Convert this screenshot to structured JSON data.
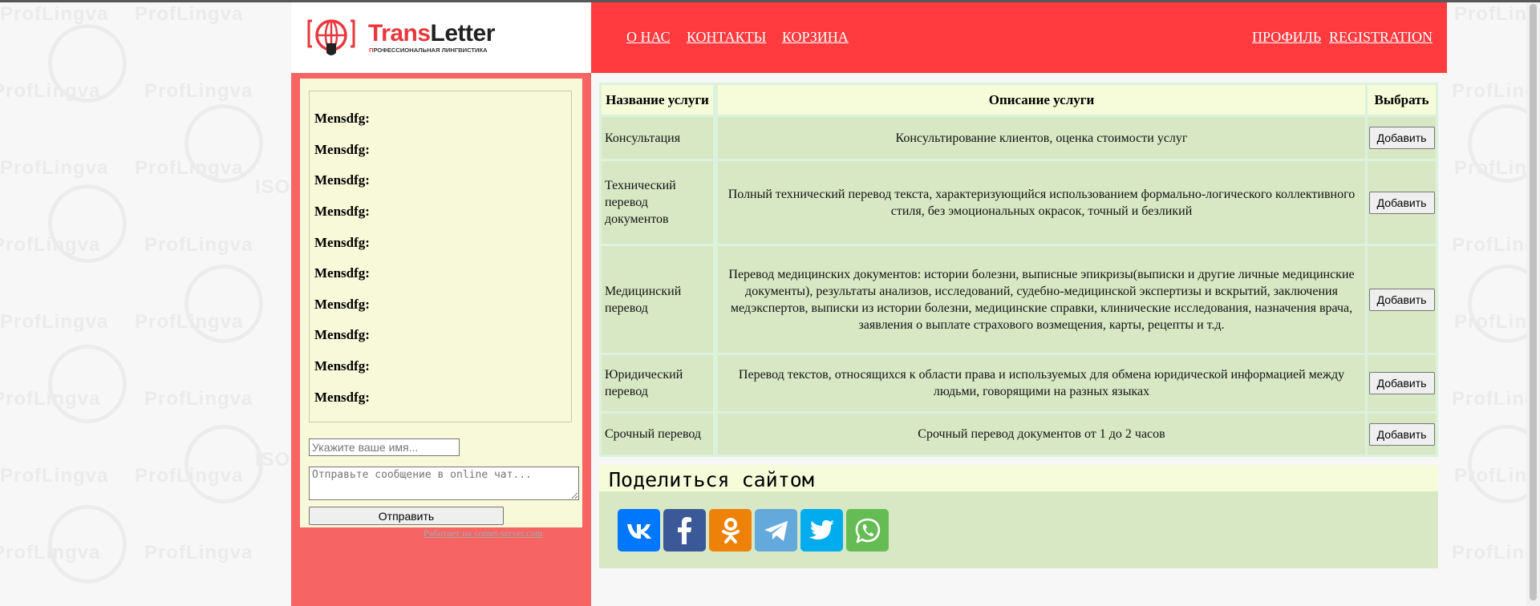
{
  "background": {
    "watermark": "ProfLingva",
    "iso": "ISO"
  },
  "brand": {
    "name_red": "Trans",
    "name_dark": "Letter",
    "tagline_red": "П",
    "tagline": "РОФЕССИОНАЛЬНАЯ ЛИНГВИСТИКА"
  },
  "nav": {
    "about": "О НАС",
    "contacts": "КОНТАКТЫ",
    "cart": "КОРЗИНА",
    "profile": "ПРОФИЛЬ",
    "registration": "REGISTRATION"
  },
  "chat": {
    "messages": [
      {
        "text": "Mensdfg:"
      },
      {
        "text": "Mensdfg:"
      },
      {
        "text": "Mensdfg:"
      },
      {
        "text": "Mensdfg:"
      },
      {
        "text": "Mensdfg:"
      },
      {
        "text": "Mensdfg:"
      },
      {
        "text": "Mensdfg:"
      },
      {
        "text": "Mensdfg:"
      },
      {
        "text": "Mensdfg:"
      },
      {
        "text": "Mensdfg:"
      }
    ],
    "name_placeholder": "Укажите ваше имя...",
    "name_value": "",
    "message_placeholder": "Отправьте сообщение в online чат...",
    "message_value": "",
    "send_label": "Отправить",
    "powered_by": "Работает на comet-server.com"
  },
  "services": {
    "headers": {
      "name": "Название услуги",
      "description": "Описание услуги",
      "select": "Выбрать"
    },
    "rows": [
      {
        "name": "Консультация",
        "description": "Консультирование клиентов, оценка стоимости услуг",
        "button": "Добавить"
      },
      {
        "name": "Технический перевод документов",
        "description": "Полный технический перевод текста, характеризующийся использованием формально-логического коллективного стиля, без эмоциональных окрасок, точный и безликий",
        "button": "Добавить"
      },
      {
        "name": "Медицинский перевод",
        "description": "Перевод медицинских документов: истории болезни, выписные эпикризы(выписки и другие личные медицинские документы), результаты анализов, исследований, судебно-медицинской экспертизы и вскрытий, заключения медэкспертов, выписки из истории болезни, медицинские справки, клинические исследования, назначения врача, заявления о выплате страхового возмещения, карты, рецепты и т.д.",
        "button": "Добавить"
      },
      {
        "name": "Юридический перевод",
        "description": "Перевод текстов, относящихся к области права и используемых для обмена юридической информацией между людьми, говорящими на разных языках",
        "button": "Добавить"
      },
      {
        "name": "Срочный перевод",
        "description": "Срочный перевод документов от 1 до 2 часов",
        "button": "Добавить"
      }
    ]
  },
  "share": {
    "title": "Поделиться сайтом",
    "buttons": [
      {
        "icon": "vk-icon",
        "color": "#0077ff"
      },
      {
        "icon": "facebook-icon",
        "color": "#3b5998"
      },
      {
        "icon": "odnoklassniki-icon",
        "color": "#ee8208"
      },
      {
        "icon": "telegram-icon",
        "color": "#64a9dc"
      },
      {
        "icon": "twitter-icon",
        "color": "#00aced"
      },
      {
        "icon": "whatsapp-icon",
        "color": "#65bc54"
      }
    ]
  },
  "colors": {
    "header_red": "#ff3b3f",
    "sidebar_red": "#f76464",
    "panel_cream": "#f7f9d8",
    "cell_green": "#d8e8c4",
    "logo_red": "#e8383d"
  }
}
